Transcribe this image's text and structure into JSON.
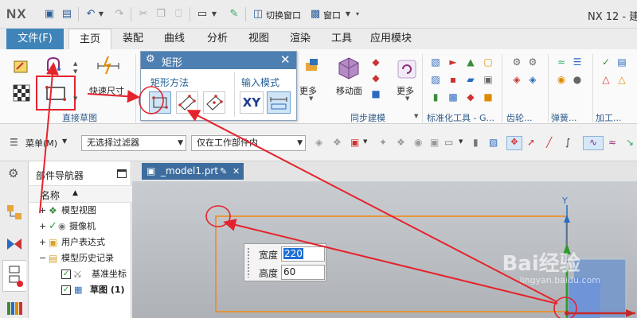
{
  "app": {
    "logo": "NX",
    "window_title": "NX 12 - 建"
  },
  "quick_access": {
    "switch_window": "切换窗口",
    "window": "窗口"
  },
  "tabs": [
    "文件(F)",
    "主页",
    "装配",
    "曲线",
    "分析",
    "视图",
    "渲染",
    "工具",
    "应用模块"
  ],
  "ribbon": {
    "rapid_dimension": "快速尺寸",
    "direct_sketch": "直接草图",
    "more1": "更多",
    "move_face": "移动面",
    "more2": "更多",
    "sync_modeling": "同步建模",
    "std_tools": "标准化工具 - G...",
    "gear": "齿轮...",
    "spring": "弹簧...",
    "process": "加工..."
  },
  "popup": {
    "title": "矩形",
    "method_label": "矩形方法",
    "input_mode_label": "输入模式",
    "xy_label": "XY"
  },
  "filterbar": {
    "menu_label": "菜单(M)",
    "filter_value": "无选择过滤器",
    "scope_value": "仅在工作部件内"
  },
  "navigator": {
    "title": "部件导航器",
    "column_header": "名称",
    "items": [
      "模型视图",
      "摄像机",
      "用户表达式",
      "模型历史记录",
      "基准坐标",
      "草图 (1)"
    ]
  },
  "graphics": {
    "doc_tab": "_model1.prt",
    "width_label": "宽度",
    "width_value": "220",
    "height_label": "高度",
    "height_value": "60",
    "axis_y": "Y",
    "watermark_main": "Bai经验",
    "watermark_sub": "jingyan.baidu.com"
  },
  "colors": {
    "accent": "#3f84b9",
    "annotation": "#e5232d",
    "sketch": "#f08a1a"
  }
}
